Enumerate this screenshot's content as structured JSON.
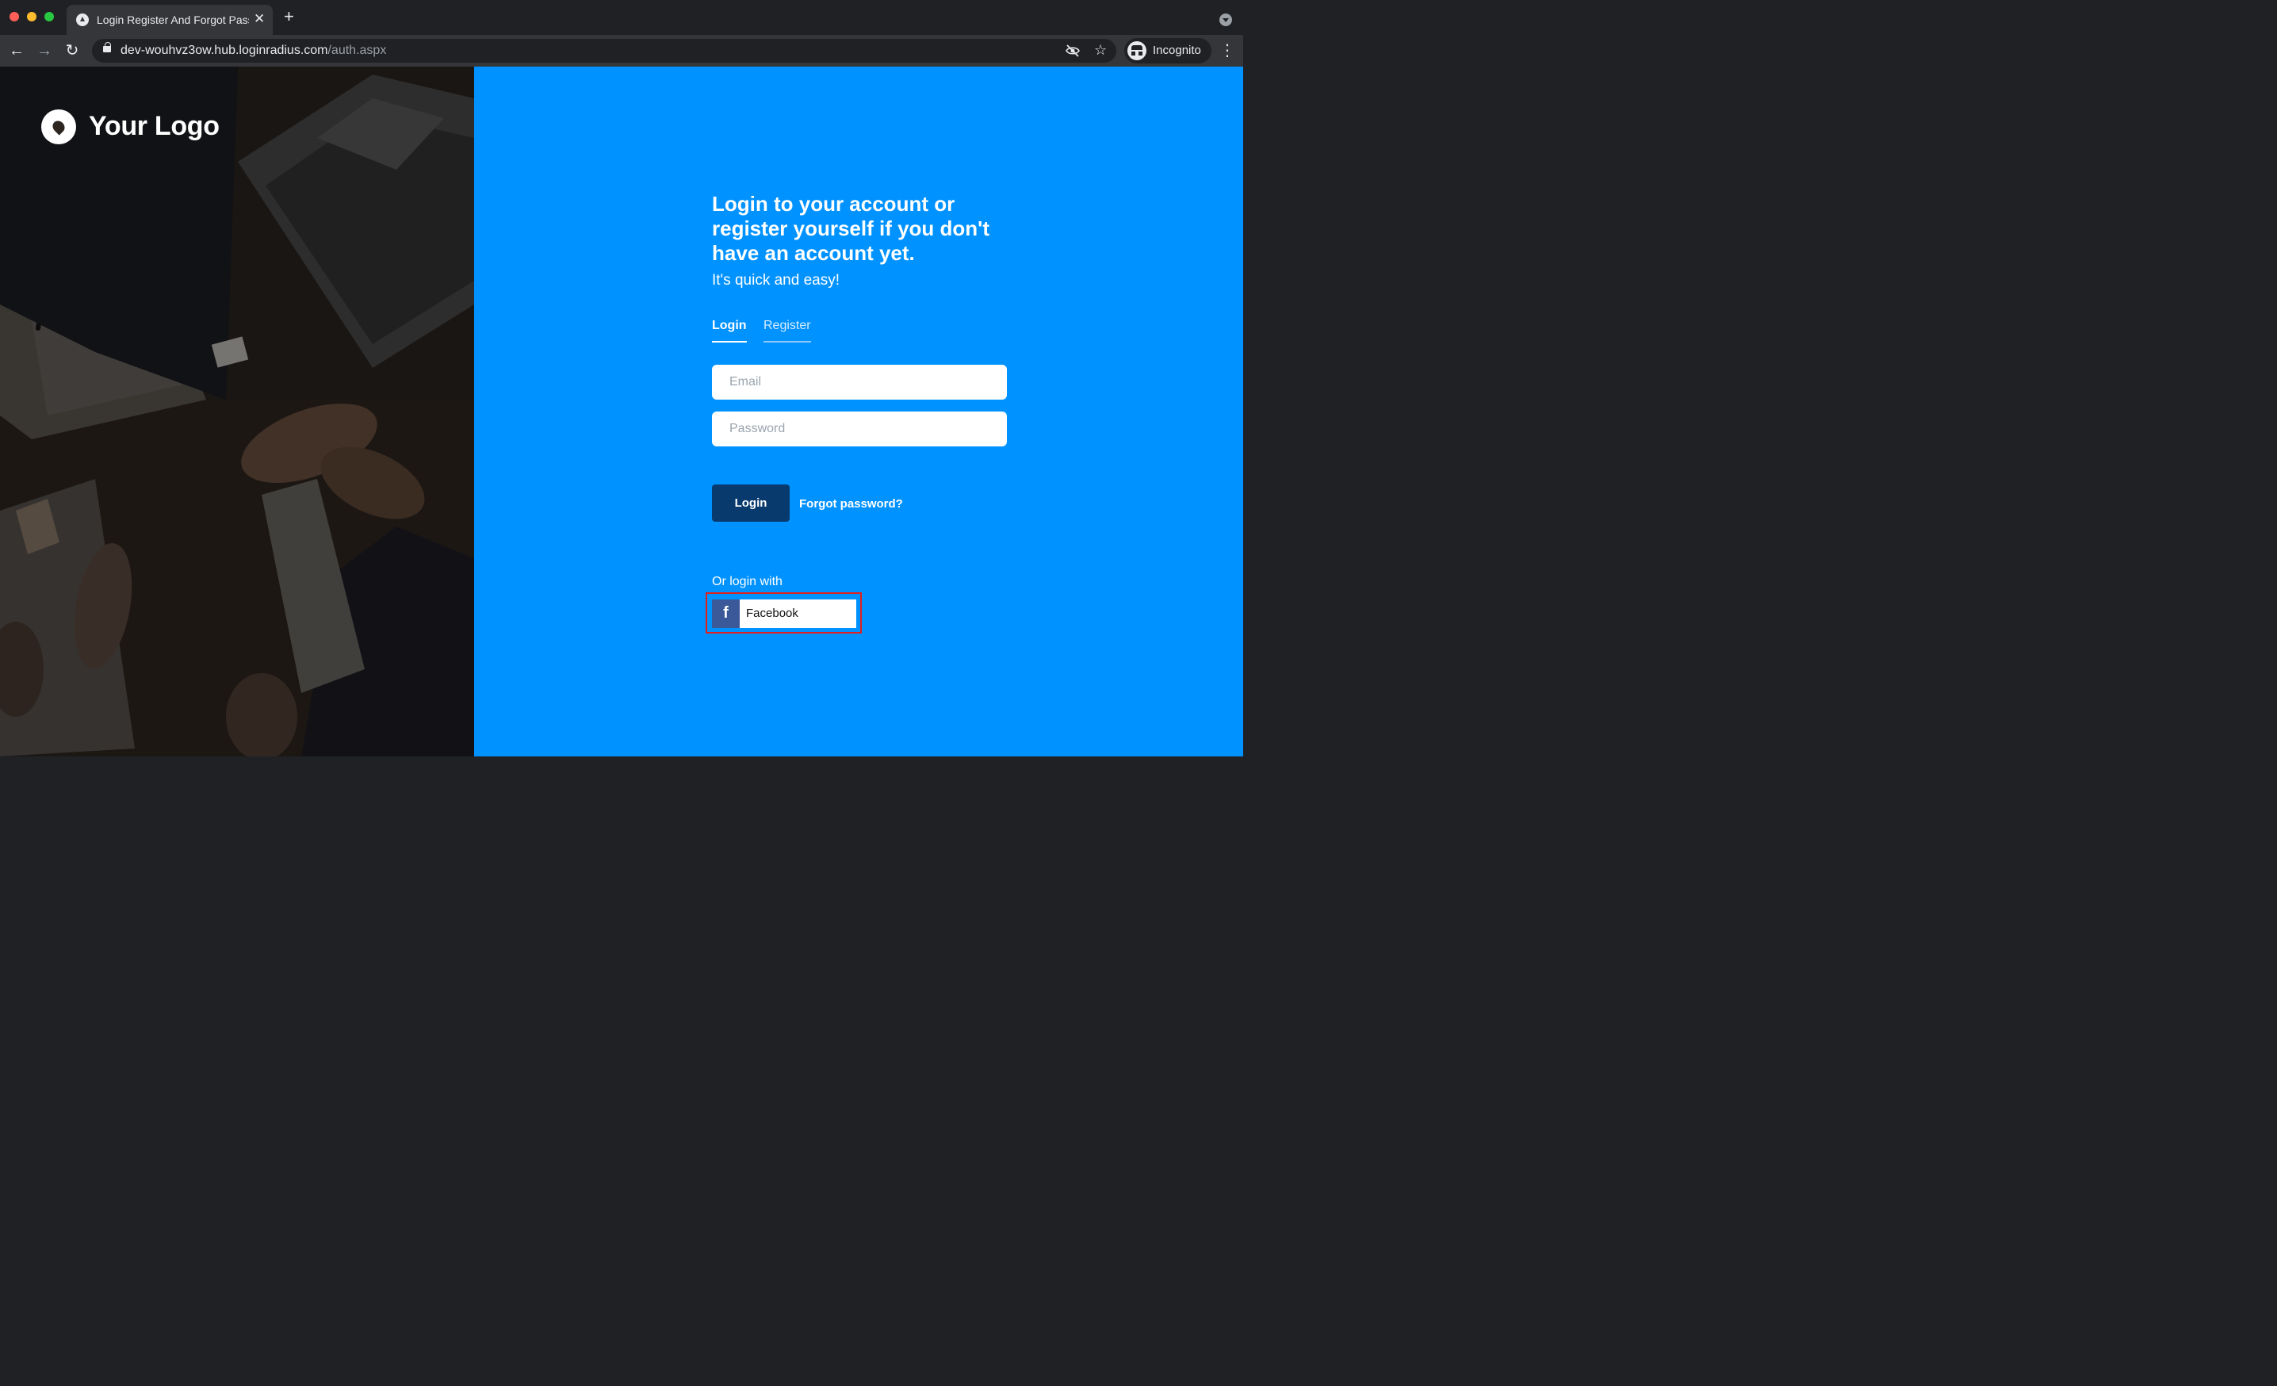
{
  "browser": {
    "tab_title": "Login Register And Forgot Pass",
    "url_host": "dev-wouhvz3ow.hub.loginradius.com",
    "url_path": "/auth.aspx",
    "profile_label": "Incognito"
  },
  "brand": {
    "logo_text": "Your Logo"
  },
  "auth": {
    "headline": "Login to your account or register yourself if you don't have an account yet.",
    "subline": "It's quick and easy!",
    "tabs": {
      "login": "Login",
      "register": "Register"
    },
    "email_placeholder": "Email",
    "password_placeholder": "Password",
    "login_button": "Login",
    "forgot_link": "Forgot password?",
    "social_heading": "Or login with",
    "facebook_label": "Facebook",
    "facebook_glyph": "f"
  },
  "colors": {
    "panel_blue": "#0092ff",
    "button_navy": "#083a6e",
    "facebook_blue": "#3b5998",
    "highlight_red": "#e3201b"
  }
}
